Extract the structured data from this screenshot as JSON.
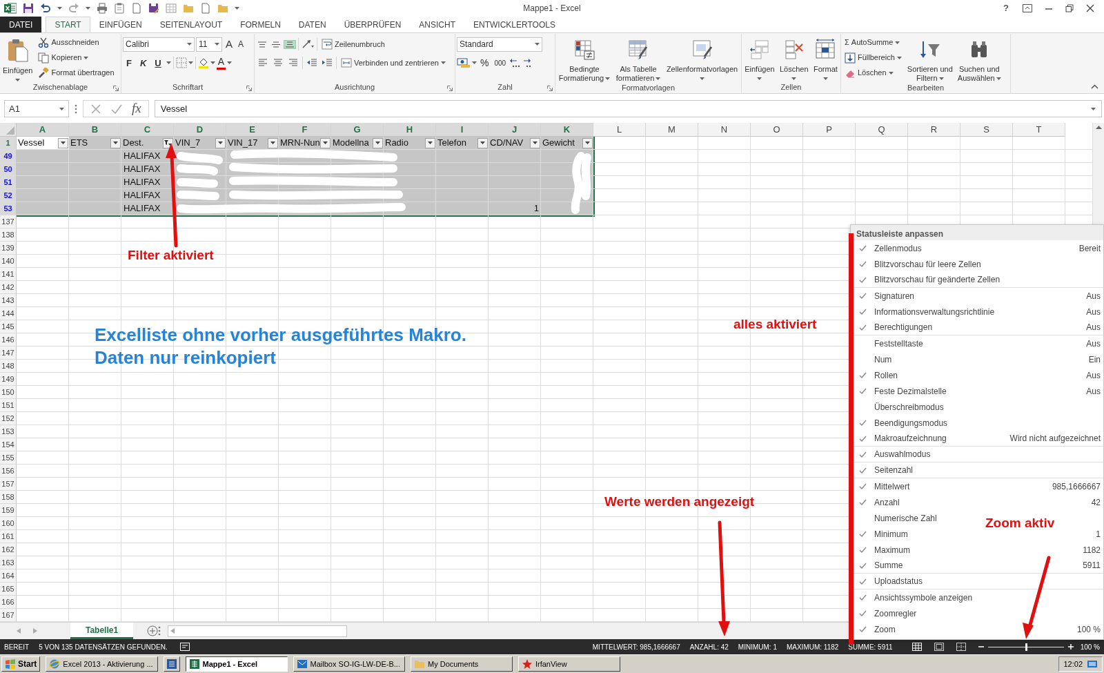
{
  "title_bar": {
    "title": "Mappe1 - Excel",
    "help": "?"
  },
  "ribbon_tabs": [
    {
      "label": "DATEI",
      "kind": "file",
      "selected": false
    },
    {
      "label": "START",
      "kind": "tab",
      "selected": true
    },
    {
      "label": "EINFÜGEN",
      "kind": "tab",
      "selected": false
    },
    {
      "label": "SEITENLAYOUT",
      "kind": "tab",
      "selected": false
    },
    {
      "label": "FORMELN",
      "kind": "tab",
      "selected": false
    },
    {
      "label": "DATEN",
      "kind": "tab",
      "selected": false
    },
    {
      "label": "ÜBERPRÜFEN",
      "kind": "tab",
      "selected": false
    },
    {
      "label": "ANSICHT",
      "kind": "tab",
      "selected": false
    },
    {
      "label": "ENTWICKLERTOOLS",
      "kind": "tab",
      "selected": false
    }
  ],
  "ribbon": {
    "clipboard": {
      "label": "Zwischenablage",
      "paste": "Einfügen",
      "cut": "Ausschneiden",
      "copy": "Kopieren",
      "format_painter": "Format übertragen"
    },
    "font": {
      "label": "Schriftart",
      "font_name": "Calibri",
      "font_size": "11",
      "grow": "A",
      "shrink": "A",
      "bold": "F",
      "italic": "K",
      "underline": "U",
      "font_color": "A"
    },
    "alignment": {
      "label": "Ausrichtung",
      "vertical_align_buttons": [
        {
          "selected": false
        },
        {
          "selected": false
        },
        {
          "selected": true
        }
      ],
      "wrap_text": "Zeilenumbruch",
      "merge": "Verbinden und zentrieren"
    },
    "number": {
      "label": "Zahl",
      "format": "Standard",
      "percent": "%",
      "thousands": "000"
    },
    "styles": {
      "label": "Formatvorlagen",
      "conditional": [
        "Bedingte",
        "Formatierung"
      ],
      "as_table": [
        "Als Tabelle",
        "formatieren"
      ],
      "cell_styles": [
        "Zellenformatvorlagen"
      ]
    },
    "cells": {
      "label": "Zellen",
      "insert": "Einfügen",
      "delete": "Löschen",
      "format": "Format"
    },
    "editing": {
      "label": "Bearbeiten",
      "sigma": "Σ",
      "autosum": "AutoSumme",
      "fill": "Füllbereich",
      "clear": "Löschen",
      "sort": [
        "Sortieren und",
        "Filtern"
      ],
      "find": [
        "Suchen und",
        "Auswählen"
      ]
    }
  },
  "formula_bar": {
    "name_box": "A1",
    "fx": "fx",
    "content": "Vessel"
  },
  "sheet": {
    "columns": [
      {
        "letter": "A",
        "selected": true
      },
      {
        "letter": "B",
        "selected": true
      },
      {
        "letter": "C",
        "selected": true
      },
      {
        "letter": "D",
        "selected": true
      },
      {
        "letter": "E",
        "selected": true
      },
      {
        "letter": "F",
        "selected": true
      },
      {
        "letter": "G",
        "selected": true
      },
      {
        "letter": "H",
        "selected": true
      },
      {
        "letter": "I",
        "selected": true
      },
      {
        "letter": "J",
        "selected": true
      },
      {
        "letter": "K",
        "selected": true
      },
      {
        "letter": "L",
        "selected": false
      },
      {
        "letter": "M",
        "selected": false
      },
      {
        "letter": "N",
        "selected": false
      },
      {
        "letter": "O",
        "selected": false
      },
      {
        "letter": "P",
        "selected": false
      },
      {
        "letter": "Q",
        "selected": false
      },
      {
        "letter": "R",
        "selected": false
      },
      {
        "letter": "S",
        "selected": false
      },
      {
        "letter": "T",
        "selected": false
      }
    ],
    "header_row": {
      "number": "1",
      "selected": true,
      "cells": [
        {
          "text": "Vessel",
          "active": true,
          "filter_active": false
        },
        {
          "text": "ETS",
          "active": false,
          "filter_active": false
        },
        {
          "text": "Dest.",
          "active": false,
          "filter_active": true
        },
        {
          "text": "VIN_7",
          "active": false,
          "filter_active": false
        },
        {
          "text": "VIN_17",
          "active": false,
          "filter_active": false
        },
        {
          "text": "MRN-Nun",
          "active": false,
          "filter_active": false
        },
        {
          "text": "Modellna",
          "active": false,
          "filter_active": false
        },
        {
          "text": "Radio",
          "active": false,
          "filter_active": false
        },
        {
          "text": "Telefon",
          "active": false,
          "filter_active": false
        },
        {
          "text": "CD/NAV",
          "active": false,
          "filter_active": false
        },
        {
          "text": "Gewicht",
          "active": false,
          "filter_active": false
        }
      ]
    },
    "rows": [
      {
        "number": "49",
        "filtered": true,
        "selected": true,
        "dest": "HALIFAX"
      },
      {
        "number": "50",
        "filtered": true,
        "selected": true,
        "dest": "HALIFAX"
      },
      {
        "number": "51",
        "filtered": true,
        "selected": true,
        "dest": "HALIFAX"
      },
      {
        "number": "52",
        "filtered": true,
        "selected": true,
        "dest": "HALIFAX"
      },
      {
        "number": "53",
        "filtered": true,
        "selected": true,
        "dest": "HALIFAX",
        "cd_nav": "1"
      },
      {
        "number": "137",
        "filtered": false,
        "selected": false
      },
      {
        "number": "138",
        "filtered": false,
        "selected": false
      },
      {
        "number": "139",
        "filtered": false,
        "selected": false
      },
      {
        "number": "140",
        "filtered": false,
        "selected": false
      },
      {
        "number": "141",
        "filtered": false,
        "selected": false
      },
      {
        "number": "142",
        "filtered": false,
        "selected": false
      },
      {
        "number": "143",
        "filtered": false,
        "selected": false
      },
      {
        "number": "144",
        "filtered": false,
        "selected": false
      },
      {
        "number": "145",
        "filtered": false,
        "selected": false
      },
      {
        "number": "146",
        "filtered": false,
        "selected": false
      },
      {
        "number": "147",
        "filtered": false,
        "selected": false
      },
      {
        "number": "148",
        "filtered": false,
        "selected": false
      },
      {
        "number": "149",
        "filtered": false,
        "selected": false
      },
      {
        "number": "150",
        "filtered": false,
        "selected": false
      },
      {
        "number": "151",
        "filtered": false,
        "selected": false
      },
      {
        "number": "152",
        "filtered": false,
        "selected": false
      },
      {
        "number": "153",
        "filtered": false,
        "selected": false
      },
      {
        "number": "154",
        "filtered": false,
        "selected": false
      },
      {
        "number": "155",
        "filtered": false,
        "selected": false
      },
      {
        "number": "156",
        "filtered": false,
        "selected": false
      },
      {
        "number": "157",
        "filtered": false,
        "selected": false
      },
      {
        "number": "158",
        "filtered": false,
        "selected": false
      },
      {
        "number": "159",
        "filtered": false,
        "selected": false
      },
      {
        "number": "160",
        "filtered": false,
        "selected": false
      },
      {
        "number": "161",
        "filtered": false,
        "selected": false
      },
      {
        "number": "162",
        "filtered": false,
        "selected": false
      },
      {
        "number": "163",
        "filtered": false,
        "selected": false
      },
      {
        "number": "164",
        "filtered": false,
        "selected": false
      },
      {
        "number": "165",
        "filtered": false,
        "selected": false
      },
      {
        "number": "166",
        "filtered": false,
        "selected": false
      },
      {
        "number": "167",
        "filtered": false,
        "selected": false
      }
    ]
  },
  "sheet_tabs": [
    {
      "label": "Tabelle1",
      "selected": true
    }
  ],
  "status_bar": {
    "mode": "BEREIT",
    "message": "5 VON 135 DATENSÄTZEN GEFUNDEN.",
    "stats": [
      "MITTELWERT: 985,1666667",
      "ANZAHL: 42",
      "MINIMUM: 1",
      "MAXIMUM: 1182",
      "SUMME: 5911"
    ],
    "zoom": {
      "level": 0.5,
      "reading": "100 %"
    }
  },
  "context_menu": {
    "title": "Statusleiste anpassen",
    "items": [
      {
        "label": "Zellenmodus",
        "value": "Bereit",
        "checked": true,
        "group_end": false
      },
      {
        "label": "Blitzvorschau für leere Zellen",
        "checked": true,
        "group_end": false
      },
      {
        "label": "Blitzvorschau für geänderte Zellen",
        "checked": true,
        "group_end": true
      },
      {
        "label": "Signaturen",
        "value": "Aus",
        "checked": true,
        "group_end": false
      },
      {
        "label": "Informationsverwaltungsrichtlinie",
        "value": "Aus",
        "checked": true,
        "group_end": false
      },
      {
        "label": "Berechtigungen",
        "value": "Aus",
        "checked": true,
        "group_end": true
      },
      {
        "label": "Feststelltaste",
        "value": "Aus",
        "checked": false,
        "group_end": false
      },
      {
        "label": "Num",
        "value": "Ein",
        "checked": false,
        "group_end": false
      },
      {
        "label": "Rollen",
        "value": "Aus",
        "checked": true,
        "group_end": false
      },
      {
        "label": "Feste Dezimalstelle",
        "value": "Aus",
        "checked": true,
        "group_end": false
      },
      {
        "label": "Überschreibmodus",
        "checked": false,
        "group_end": false
      },
      {
        "label": "Beendigungsmodus",
        "checked": true,
        "group_end": false
      },
      {
        "label": "Makroaufzeichnung",
        "value": "Wird nicht aufgezeichnet",
        "checked": true,
        "group_end": true
      },
      {
        "label": "Auswahlmodus",
        "checked": true,
        "group_end": true
      },
      {
        "label": "Seitenzahl",
        "checked": true,
        "group_end": true
      },
      {
        "label": "Mittelwert",
        "value": "985,1666667",
        "checked": true,
        "group_end": false
      },
      {
        "label": "Anzahl",
        "value": "42",
        "checked": true,
        "group_end": false
      },
      {
        "label": "Numerische Zahl",
        "checked": false,
        "group_end": false
      },
      {
        "label": "Minimum",
        "value": "1",
        "checked": true,
        "group_end": false
      },
      {
        "label": "Maximum",
        "value": "1182",
        "checked": true,
        "group_end": false
      },
      {
        "label": "Summe",
        "value": "5911",
        "checked": true,
        "group_end": true
      },
      {
        "label": "Uploadstatus",
        "checked": true,
        "group_end": true
      },
      {
        "label": "Ansichtssymbole anzeigen",
        "checked": true,
        "group_end": false
      },
      {
        "label": "Zoomregler",
        "checked": true,
        "group_end": false
      },
      {
        "label": "Zoom",
        "value": "100 %",
        "checked": true,
        "group_end": false
      }
    ]
  },
  "taskbar": {
    "start": "Start",
    "buttons": [
      {
        "label": "Excel 2013 - Aktivierung ...",
        "selected": false
      },
      {
        "selected": false
      },
      {
        "label": "Mappe1 - Excel",
        "selected": true
      },
      {
        "label": "Mailbox SO-IG-LW-DE-B...",
        "selected": false
      },
      {
        "label": "My Documents",
        "selected": false
      },
      {
        "label": "IrfanView",
        "selected": false
      }
    ],
    "clock": "12:02"
  },
  "annotations": [
    {
      "text": "Filter aktiviert",
      "kind": "red"
    },
    {
      "text": "Excelliste ohne vorher ausgeführtes Makro.",
      "kind": "blue"
    },
    {
      "text": "Daten nur reinkopiert",
      "kind": "blue"
    },
    {
      "text": "alles aktiviert",
      "kind": "red"
    },
    {
      "text": "Werte werden angezeigt",
      "kind": "red"
    },
    {
      "text": "Zoom aktiv",
      "kind": "red"
    }
  ]
}
